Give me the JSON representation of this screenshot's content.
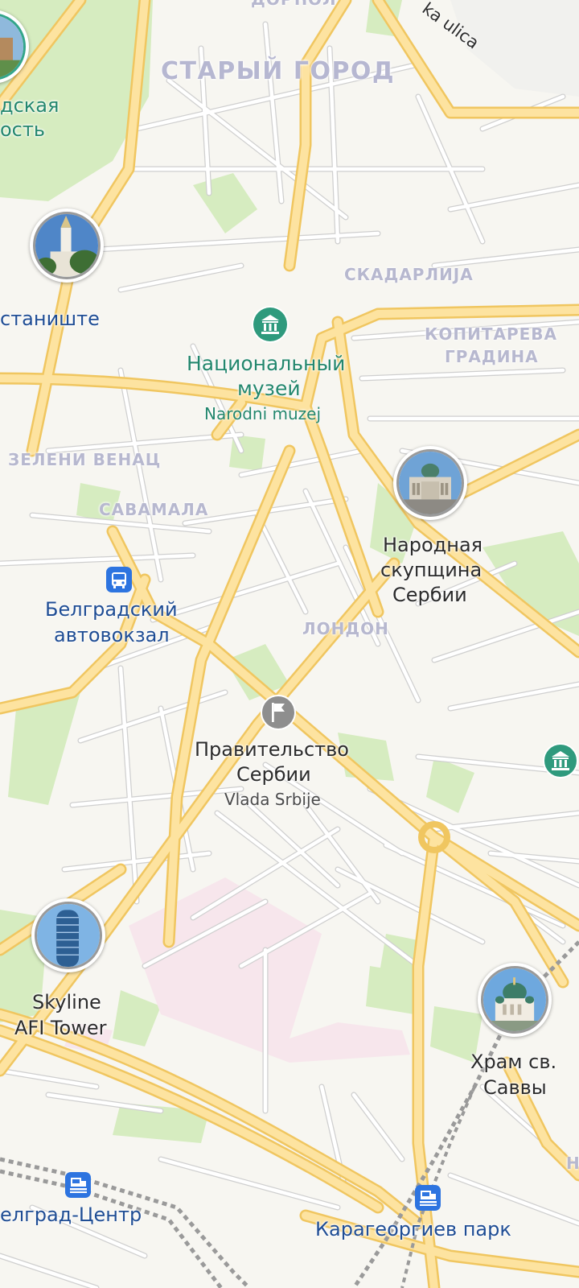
{
  "map": {
    "districts": [
      {
        "id": "stari-grad",
        "text": "СТАРЫЙ ГОРОД"
      },
      {
        "id": "dorcol",
        "text": "ДОРЋОЛ"
      },
      {
        "id": "skadarlija",
        "text": "СКАДАРЛИЈА"
      },
      {
        "id": "kopitareva-1",
        "text": "КОПИТАРЕВА"
      },
      {
        "id": "kopitareva-2",
        "text": "ГРАДИНА"
      },
      {
        "id": "zeleni-venac",
        "text": "ЗЕЛЕНИ ВЕНАЦ"
      },
      {
        "id": "savamala",
        "text": "САВАМАЛА"
      },
      {
        "id": "london",
        "text": "ЛОНДОН"
      }
    ],
    "streets": [
      {
        "id": "ka-ulica",
        "text": "ka ulica"
      }
    ],
    "pois": {
      "fortress": {
        "line1": "дская",
        "line2": "ость",
        "icon": "fortress-photo-icon"
      },
      "saborna": {
        "line1": "станиште",
        "icon": "church-photo-icon"
      },
      "national_museum": {
        "line1": "Национальный",
        "line2": "музей",
        "sub": "Narodni muzej",
        "icon": "museum-icon"
      },
      "parliament": {
        "line1": "Народная",
        "line2": "скупщина",
        "line3": "Сербии",
        "icon": "parliament-photo-icon"
      },
      "bus_station": {
        "line1": "Белградский",
        "line2": "автовокзал",
        "icon": "bus-icon"
      },
      "government": {
        "line1": "Правительство",
        "line2": "Сербии",
        "sub": "Vlada Srbije",
        "icon": "flag-icon"
      },
      "skyline": {
        "line1": "Skyline",
        "line2": "AFI Tower",
        "icon": "tower-photo-icon"
      },
      "sava": {
        "line1": "Храм св.",
        "line2": "Саввы",
        "icon": "temple-photo-icon"
      },
      "beograd_centar": {
        "line1": "елград-Центр",
        "icon": "train-icon"
      },
      "karadjordjev": {
        "line1": "Карагеоргиев парк",
        "icon": "train-icon"
      },
      "museum_right": {
        "icon": "museum-icon"
      },
      "partial_right": {
        "text": "Н"
      }
    },
    "colors": {
      "background": "#f7f6f1",
      "park": "#d6ecc0",
      "major_road": "#fbd97e",
      "minor_road": "#ffffff",
      "museum_green": "#2f9a7d",
      "transit_blue": "#2d74e0",
      "railway": "#9a9a9a"
    }
  }
}
